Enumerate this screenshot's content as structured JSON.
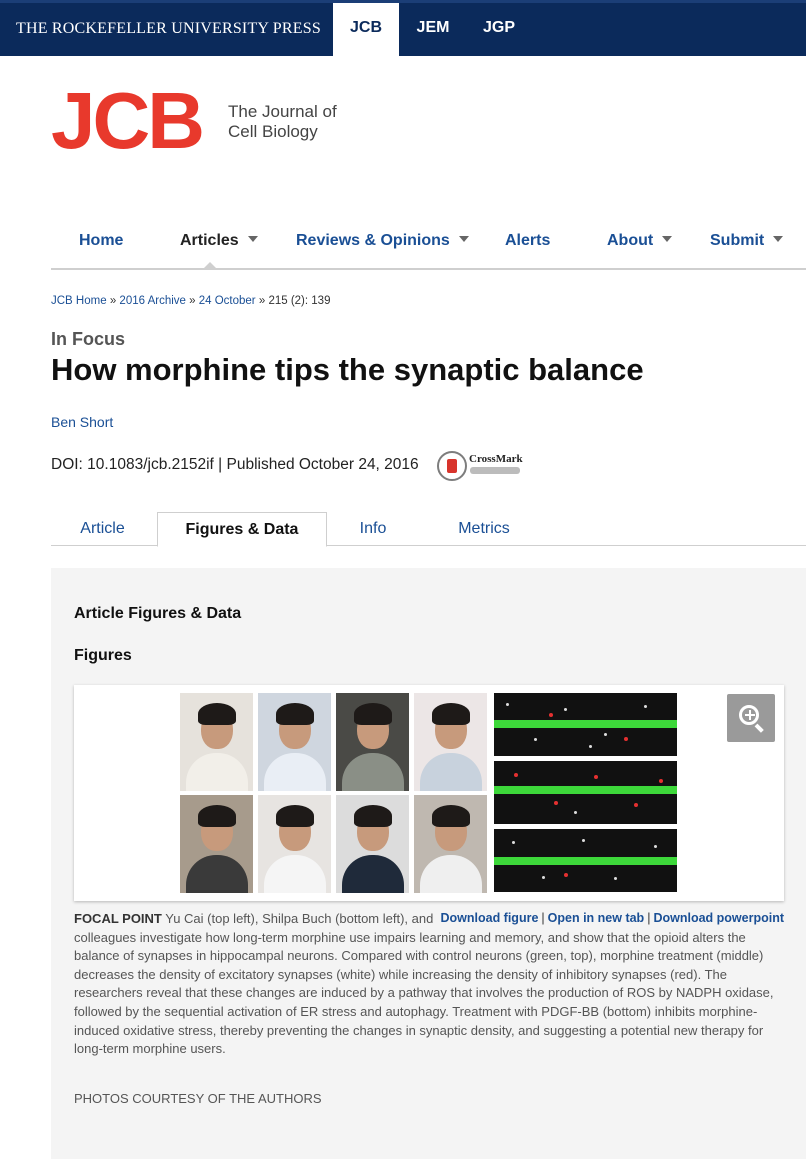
{
  "topbar": {
    "press": "THE ROCKEFELLER UNIVERSITY PRESS",
    "journals": [
      "JCB",
      "JEM",
      "JGP"
    ],
    "active_journal": "JCB"
  },
  "logo": {
    "mark": "JCB",
    "tagline_line1": "The Journal of",
    "tagline_line2": "Cell Biology"
  },
  "nav": {
    "items": [
      {
        "label": "Home"
      },
      {
        "label": "Articles"
      },
      {
        "label": "Reviews & Opinions"
      },
      {
        "label": "Alerts"
      },
      {
        "label": "About"
      },
      {
        "label": "Submit"
      }
    ]
  },
  "breadcrumb": {
    "home": "JCB Home",
    "archive": "2016 Archive",
    "issue": "24 October",
    "current": "215 (2): 139",
    "separator": "»"
  },
  "article": {
    "section": "In Focus",
    "title": "How morphine tips the synaptic balance",
    "author": "Ben Short",
    "doi_line": "DOI: 10.1083/jcb.2152if | Published October 24, 2016",
    "crossmark_label": "CrossMark"
  },
  "tabs": [
    {
      "label": "Article"
    },
    {
      "label": "Figures & Data"
    },
    {
      "label": "Info"
    },
    {
      "label": "Metrics"
    }
  ],
  "figures_panel": {
    "heading": "Article Figures & Data",
    "subheading": "Figures",
    "links": {
      "download_figure": "Download figure",
      "open_new_tab": "Open in new tab",
      "download_powerpoint": "Download powerpoint",
      "separator": "|"
    },
    "caption_lead": "FOCAL POINT",
    "caption_text": " Yu Cai (top left), Shilpa Buch (bottom left), and colleagues investigate how long-term morphine use impairs learning and memory, and show that the opioid alters the balance of synapses in hippocampal neurons. Compared with control neurons (green, top), morphine treatment (middle) decreases the density of excitatory synapses (white) while increasing the density of inhibitory synapses (red). The researchers reveal that these changes are induced by a pathway that involves the production of ROS by NADPH oxidase, followed by the sequential activation of ER stress and autophagy. Treatment with PDGF-BB (bottom) inhibits morphine-induced oxidative stress, thereby preventing the changes in synaptic density, and suggesting a potential new therapy for long-term morphine users.",
    "credit": "PHOTOS COURTESY OF THE AUTHORS"
  },
  "colors": {
    "topbar": "#0b2a5b",
    "logo_red": "#e8392c",
    "link_blue": "#1a4f95",
    "panel_bg": "#f4f4f4"
  }
}
